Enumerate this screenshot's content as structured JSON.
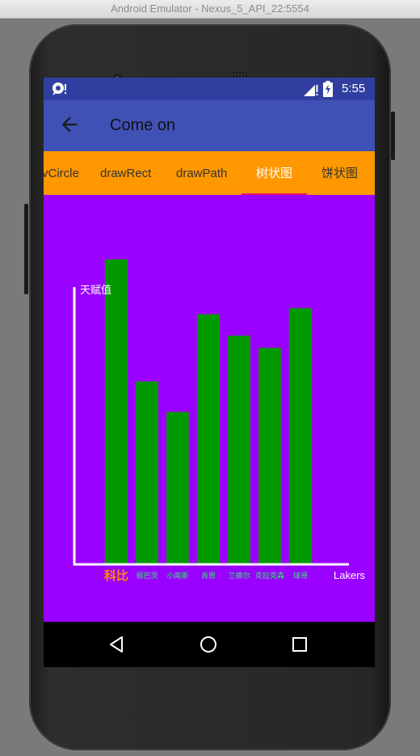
{
  "emulator": {
    "window_title": "Android Emulator - Nexus_5_API_22:5554"
  },
  "status_bar": {
    "time": "5:55"
  },
  "app_bar": {
    "title": "Come on"
  },
  "tabs": [
    {
      "label": "drawCircle",
      "visible_text": "vCircle",
      "active": false
    },
    {
      "label": "drawRect",
      "visible_text": "drawRect",
      "active": false
    },
    {
      "label": "drawPath",
      "visible_text": "drawPath",
      "active": false
    },
    {
      "label": "树状图",
      "visible_text": "树状图",
      "active": true
    },
    {
      "label": "饼状图",
      "visible_text": "饼状图",
      "active": false
    }
  ],
  "colors": {
    "status_bar": "#303f9f",
    "app_bar": "#3f51b5",
    "tab_bar": "#ff9800",
    "tab_indicator": "#e91e63",
    "content_bg": "#9900ff",
    "bar_fill": "#009900",
    "axis": "#ffffff",
    "highlight_label": "#ff8800",
    "category_label": "#33ee66"
  },
  "chart_data": {
    "type": "bar",
    "ylabel": "天赋值",
    "xlabel": "Lakers",
    "categories": [
      "科比",
      "祖巴茨",
      "小南斯",
      "肖恩",
      "兰德尔",
      "克拉克森",
      "球哥"
    ],
    "values": [
      100,
      60,
      50,
      82,
      75,
      71,
      84
    ],
    "ylim": [
      0,
      106
    ],
    "grid": false,
    "highlight_category": "科比"
  },
  "nav_icons": [
    "back-icon",
    "home-icon",
    "recents-icon"
  ]
}
